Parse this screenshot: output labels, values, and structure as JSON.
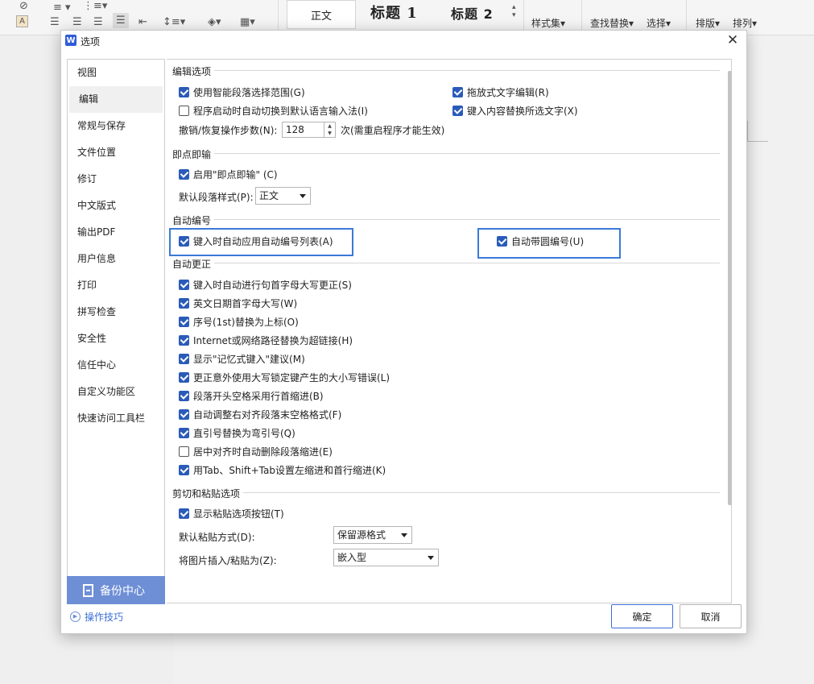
{
  "toolbar": {
    "style_normal": "正文",
    "style_h1": "标题 1",
    "style_h2": "标题 2",
    "style_set": "样式集",
    "find_replace": "查找替换",
    "select": "选择",
    "layout": "排版",
    "arrange": "排列"
  },
  "dialog": {
    "title": "选项",
    "logo": "W",
    "close": "✕",
    "ok": "确定",
    "cancel": "取消",
    "backup": "备份中心",
    "tips": "操作技巧"
  },
  "nav": [
    {
      "label": "视图"
    },
    {
      "label": "编辑",
      "active": true
    },
    {
      "label": "常规与保存"
    },
    {
      "label": "文件位置"
    },
    {
      "label": "修订"
    },
    {
      "label": "中文版式"
    },
    {
      "label": "输出PDF"
    },
    {
      "label": "用户信息"
    },
    {
      "label": "打印"
    },
    {
      "label": "拼写检查"
    },
    {
      "label": "安全性"
    },
    {
      "label": "信任中心"
    },
    {
      "label": "自定义功能区"
    },
    {
      "label": "快速访问工具栏"
    }
  ],
  "edit": {
    "title": "编辑选项",
    "smart_para": {
      "label": "使用智能段落选择范围(G)",
      "checked": true
    },
    "drag_edit": {
      "label": "拖放式文字编辑(R)",
      "checked": true
    },
    "auto_ime": {
      "label": "程序启动时自动切换到默认语言输入法(I)",
      "checked": false
    },
    "typing_replace": {
      "label": "键入内容替换所选文字(X)",
      "checked": true
    },
    "undo_label": "撤销/恢复操作步数(N):",
    "undo_value": "128",
    "undo_suffix": "次(需重启程序才能生效)"
  },
  "click_type": {
    "title": "即点即输",
    "enable": {
      "label": "启用\"即点即输\" (C)",
      "checked": true
    },
    "default_style_label": "默认段落样式(P):",
    "default_style_value": "正文"
  },
  "auto_number": {
    "title": "自动编号",
    "auto_list": {
      "label": "键入时自动应用自动编号列表(A)",
      "checked": true
    },
    "circled": {
      "label": "自动带圆编号(U)",
      "checked": true
    }
  },
  "auto_correct": {
    "title": "自动更正",
    "items": [
      {
        "label": "键入时自动进行句首字母大写更正(S)",
        "checked": true
      },
      {
        "label": "英文日期首字母大写(W)",
        "checked": true
      },
      {
        "label": "序号(1st)替换为上标(O)",
        "checked": true
      },
      {
        "label": "Internet或网络路径替换为超链接(H)",
        "checked": true
      },
      {
        "label": "显示\"记忆式键入\"建议(M)",
        "checked": true
      },
      {
        "label": "更正意外使用大写锁定键产生的大小写错误(L)",
        "checked": true
      },
      {
        "label": "段落开头空格采用行首缩进(B)",
        "checked": true
      },
      {
        "label": "自动调整右对齐段落末空格格式(F)",
        "checked": true
      },
      {
        "label": "直引号替换为弯引号(Q)",
        "checked": true
      },
      {
        "label": "居中对齐时自动删除段落缩进(E)",
        "checked": false
      },
      {
        "label": "用Tab、Shift+Tab设置左缩进和首行缩进(K)",
        "checked": true
      }
    ]
  },
  "paste": {
    "title": "剪切和粘贴选项",
    "show_button": {
      "label": "显示粘贴选项按钮(T)",
      "checked": true
    },
    "default_label": "默认粘贴方式(D):",
    "default_value": "保留源格式",
    "image_label": "将图片插入/粘贴为(Z):",
    "image_value": "嵌入型"
  },
  "colors": {
    "checkbox": "#2b5bb8",
    "highlight": "#3a7ad8",
    "backup_bg": "#6e8fd6"
  }
}
